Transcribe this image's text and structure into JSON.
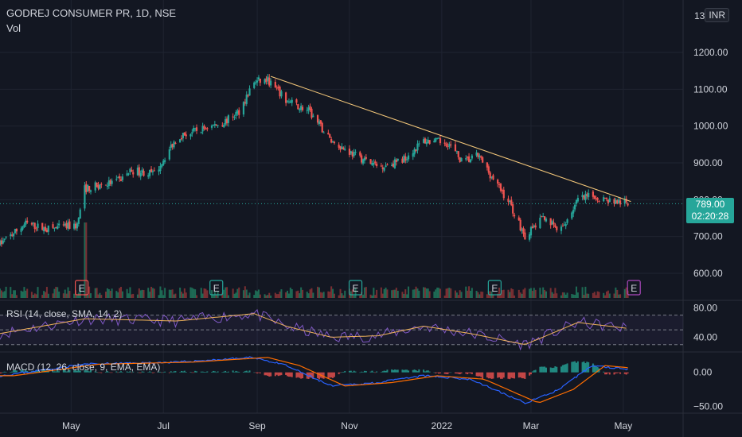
{
  "header": {
    "symbol_line": "GODREJ CONSUMER PR, 1D, NSE",
    "vol_label": "Vol",
    "currency": "INR"
  },
  "price_axis": {
    "ticks": [
      "1200.00",
      "1100.00",
      "1000.00",
      "900.00",
      "800.00",
      "700.00",
      "600.00"
    ],
    "top_cut_label": "13"
  },
  "last_price": {
    "value": "789.00",
    "countdown": "02:20:28"
  },
  "rsi": {
    "label": "RSI (14, close, SMA, 14, 2)",
    "ticks": [
      "80.00",
      "40.00"
    ]
  },
  "macd": {
    "label": "MACD (12, 26, close, 9, EMA, EMA)",
    "ticks": [
      "0.00",
      "−50.00"
    ]
  },
  "time_axis": [
    "May",
    "Jul",
    "Sep",
    "Nov",
    "2022",
    "Mar",
    "May"
  ],
  "earnings_markers": [
    "E",
    "E",
    "E",
    "E",
    "E"
  ],
  "colors": {
    "background": "#131722",
    "up": "#26a69a",
    "down": "#ef5350",
    "trendline": "#f5c87a",
    "rsi_line": "#7e57c2",
    "rsi_sma": "#f0b35a",
    "macd_line": "#2962ff",
    "signal_line": "#ff6d00",
    "last_price": "#26a69a"
  },
  "chart_data": {
    "type": "candlestick",
    "title": "GODREJ CONSUMER PR, 1D, NSE",
    "ylim": [
      560,
      1300
    ],
    "price_path": [
      [
        "2021-03-15",
        680
      ],
      [
        "2021-04-01",
        735
      ],
      [
        "2021-04-15",
        720
      ],
      [
        "2021-05-05",
        730
      ],
      [
        "2021-05-10",
        830
      ],
      [
        "2021-06-01",
        850
      ],
      [
        "2021-06-10",
        880
      ],
      [
        "2021-06-25",
        870
      ],
      [
        "2021-07-10",
        970
      ],
      [
        "2021-07-25",
        990
      ],
      [
        "2021-08-10",
        1010
      ],
      [
        "2021-08-20",
        1040
      ],
      [
        "2021-08-30",
        1120
      ],
      [
        "2021-09-08",
        1125
      ],
      [
        "2021-09-20",
        1070
      ],
      [
        "2021-10-05",
        1040
      ],
      [
        "2021-10-20",
        960
      ],
      [
        "2021-11-05",
        920
      ],
      [
        "2021-11-20",
        890
      ],
      [
        "2021-12-05",
        905
      ],
      [
        "2021-12-20",
        960
      ],
      [
        "2022-01-05",
        955
      ],
      [
        "2022-01-15",
        900
      ],
      [
        "2022-01-25",
        920
      ],
      [
        "2022-02-05",
        850
      ],
      [
        "2022-02-15",
        790
      ],
      [
        "2022-02-25",
        700
      ],
      [
        "2022-03-10",
        755
      ],
      [
        "2022-03-20",
        710
      ],
      [
        "2022-04-01",
        800
      ],
      [
        "2022-04-10",
        810
      ],
      [
        "2022-04-20",
        800
      ],
      [
        "2022-05-04",
        789
      ]
    ],
    "trendline": [
      [
        "2021-09-10",
        1135
      ],
      [
        "2022-05-06",
        795
      ]
    ],
    "rsi_range": [
      20,
      90
    ],
    "rsi_bands": [
      70,
      50,
      30
    ],
    "rsi_path": [
      [
        "2021-03-15",
        45
      ],
      [
        "2021-05-10",
        65
      ],
      [
        "2021-07-10",
        62
      ],
      [
        "2021-08-30",
        72
      ],
      [
        "2021-09-20",
        55
      ],
      [
        "2021-10-20",
        40
      ],
      [
        "2021-11-20",
        42
      ],
      [
        "2021-12-20",
        55
      ],
      [
        "2022-01-20",
        45
      ],
      [
        "2022-02-25",
        30
      ],
      [
        "2022-04-01",
        60
      ],
      [
        "2022-05-04",
        52
      ]
    ],
    "macd_range": [
      -60,
      30
    ],
    "macd_path": [
      [
        "2021-03-15",
        -5
      ],
      [
        "2021-05-10",
        12
      ],
      [
        "2021-07-10",
        15
      ],
      [
        "2021-08-30",
        22
      ],
      [
        "2021-09-20",
        10
      ],
      [
        "2021-10-20",
        -20
      ],
      [
        "2021-11-20",
        -15
      ],
      [
        "2021-12-20",
        -5
      ],
      [
        "2022-01-20",
        -10
      ],
      [
        "2022-02-25",
        -45
      ],
      [
        "2022-03-20",
        -25
      ],
      [
        "2022-04-10",
        10
      ],
      [
        "2022-05-04",
        5
      ]
    ],
    "time_ticks": [
      [
        "2021-05-01",
        "May"
      ],
      [
        "2021-07-01",
        "Jul"
      ],
      [
        "2021-09-01",
        "Sep"
      ],
      [
        "2021-11-01",
        "Nov"
      ],
      [
        "2022-01-01",
        "2022"
      ],
      [
        "2022-03-01",
        "Mar"
      ],
      [
        "2022-05-01",
        "May"
      ]
    ],
    "earnings_dates": [
      "2021-05-08",
      "2021-08-05",
      "2021-11-05",
      "2022-02-05",
      "2022-05-08"
    ],
    "y_ticks": [
      1200,
      1100,
      1000,
      900,
      800,
      700,
      600
    ],
    "last": 789
  }
}
